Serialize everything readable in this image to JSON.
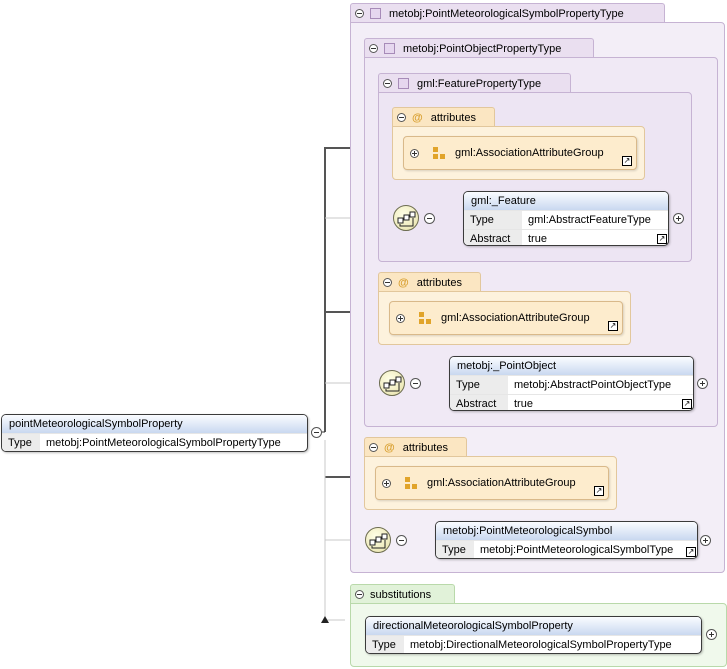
{
  "complex_types": {
    "outer": "metobj:PointMeteorologicalSymbolPropertyType",
    "middle": "metobj:PointObjectPropertyType",
    "inner": "gml:FeaturePropertyType"
  },
  "attributes": {
    "label": "attributes",
    "group": "gml:AssociationAttributeGroup"
  },
  "elements": {
    "feature": {
      "name": "gml:_Feature",
      "type_key": "Type",
      "type_value": "gml:AbstractFeatureType",
      "abstract_key": "Abstract",
      "abstract_value": "true"
    },
    "point_object": {
      "name": "metobj:_PointObject",
      "type_key": "Type",
      "type_value": "metobj:AbstractPointObjectType",
      "abstract_key": "Abstract",
      "abstract_value": "true"
    },
    "symbol": {
      "name": "metobj:PointMeteorologicalSymbol",
      "type_key": "Type",
      "type_value": "metobj:PointMeteorologicalSymbolType"
    },
    "root": {
      "name": "pointMeteorologicalSymbolProperty",
      "type_key": "Type",
      "type_value": "metobj:PointMeteorologicalSymbolPropertyType"
    },
    "directional": {
      "name": "directionalMeteorologicalSymbolProperty",
      "type_key": "Type",
      "type_value": "metobj:DirectionalMeteorologicalSymbolPropertyType"
    }
  },
  "substitutions": {
    "label": "substitutions"
  },
  "icons": {
    "complex_type": "complex-type-icon",
    "attribute": "attribute-at-icon",
    "group": "attribute-group-icon",
    "sequence": "sequence-icon",
    "link": "link-arrow-icon"
  }
}
